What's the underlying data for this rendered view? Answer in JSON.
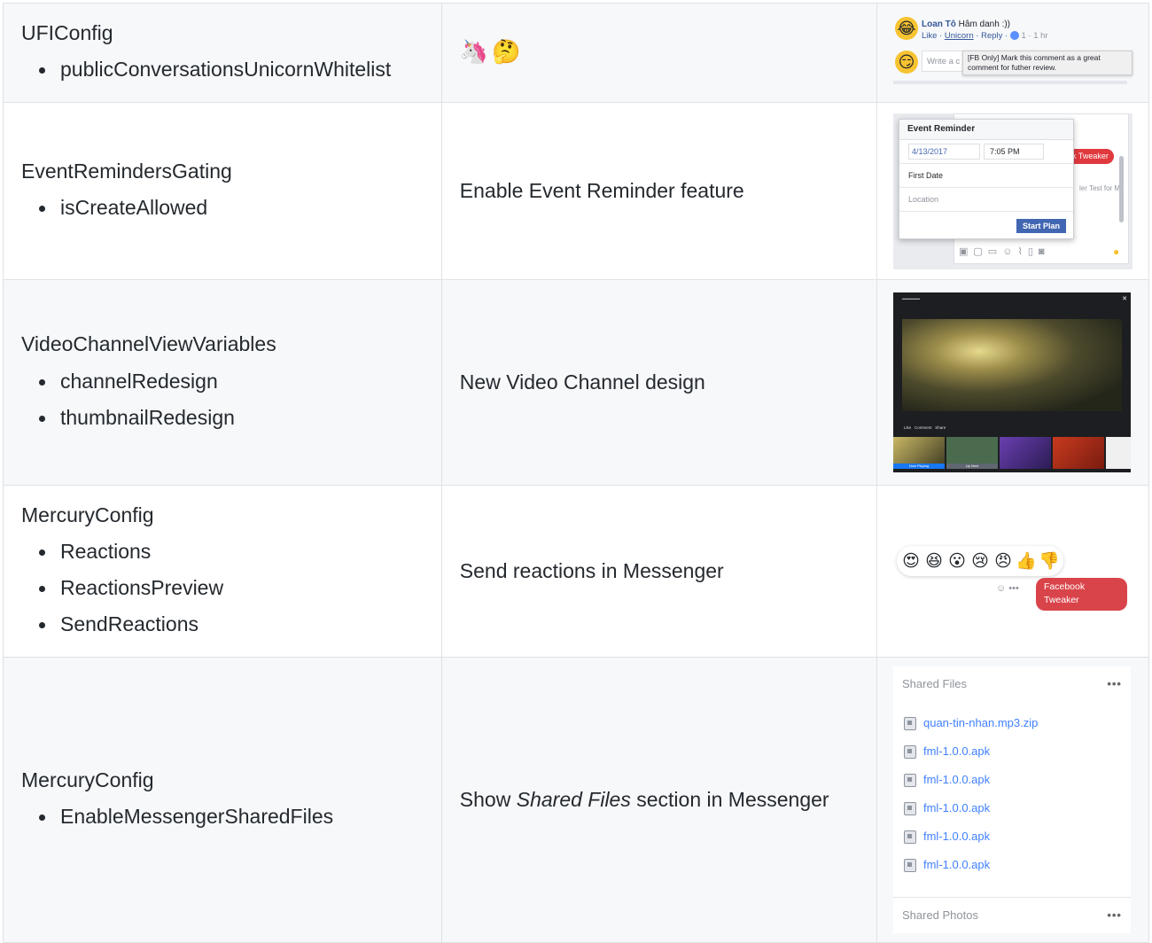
{
  "rows": [
    {
      "gatekeeper": "UFIConfig",
      "variables": [
        "publicConversationsUnicornWhitelist"
      ],
      "description_emoji": [
        "🦄",
        "🤔"
      ],
      "shot": {
        "commenter_name": "Loan Tô",
        "comment_text": "Hâm danh :))",
        "actions": [
          "Like",
          "Unicorn",
          "Reply"
        ],
        "like_count": "1",
        "time": "1 hr",
        "input_placeholder": "Write a c",
        "tooltip": "[FB Only] Mark this comment as a great comment for futher review."
      }
    },
    {
      "gatekeeper": "EventRemindersGating",
      "variables": [
        "isCreateAllowed"
      ],
      "description": "Enable Event Reminder feature",
      "shot": {
        "title": "Event Reminder",
        "date": "4/13/2017",
        "time": "7:05 PM",
        "event_name": "First Date",
        "location_placeholder": "Location",
        "button": "Start Plan",
        "tweaker_label": "k Tweaker",
        "background_text": "ler Test for M."
      }
    },
    {
      "gatekeeper": "VideoChannelViewVariables",
      "variables": [
        "channelRedesign",
        "thumbnailRedesign"
      ],
      "description": "New Video Channel design",
      "shot": {
        "actions": [
          "Like",
          "Comment",
          "Share"
        ],
        "thumb_labels": [
          "Now Playing",
          "Up Next"
        ]
      }
    },
    {
      "gatekeeper": "MercuryConfig",
      "variables": [
        "Reactions",
        "ReactionsPreview",
        "SendReactions"
      ],
      "description": "Send reactions in Messenger",
      "shot": {
        "reactions": [
          "😍",
          "😆",
          "😮",
          "😢",
          "😠",
          "👍",
          "👎"
        ],
        "tweaker_label": "Facebook Tweaker"
      }
    },
    {
      "gatekeeper": "MercuryConfig",
      "variables": [
        "EnableMessengerSharedFiles"
      ],
      "description_pre": "Show ",
      "description_em": "Shared Files",
      "description_post": " section in Messenger",
      "shot": {
        "files_header": "Shared Files",
        "files": [
          "quan-tin-nhan.mp3.zip",
          "fml-1.0.0.apk",
          "fml-1.0.0.apk",
          "fml-1.0.0.apk",
          "fml-1.0.0.apk",
          "fml-1.0.0.apk"
        ],
        "photos_header": "Shared Photos",
        "more_label": "•••"
      }
    }
  ],
  "colors": {
    "row_alt_bg": "#f6f8fa",
    "border": "#dfe2e5",
    "text": "#24292e",
    "fb_link": "#4080ff",
    "fb_button": "#4267b2",
    "tweaker_red": "#d9444a"
  }
}
